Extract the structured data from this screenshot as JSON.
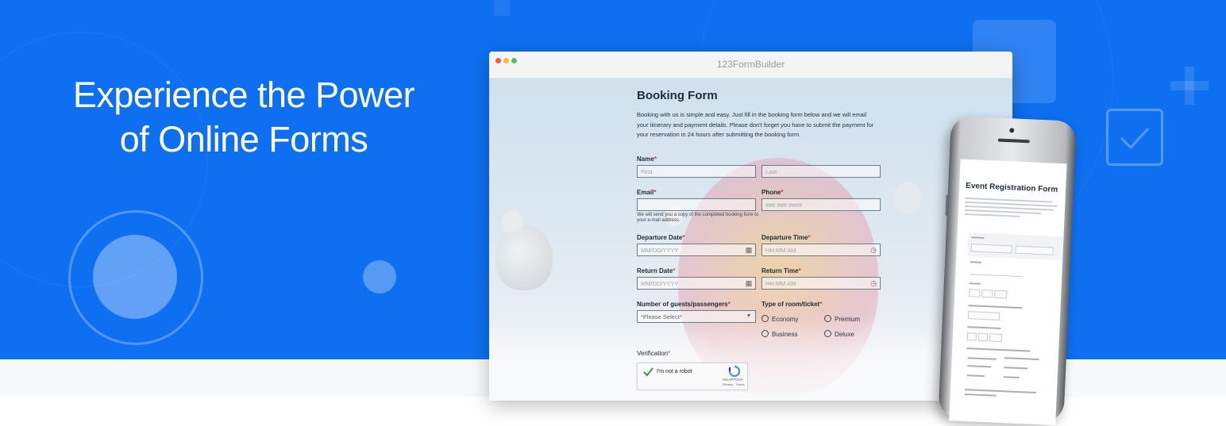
{
  "hero": {
    "headline_line1": "Experience the Power",
    "headline_line2": "of Online Forms"
  },
  "browser": {
    "title": "123FormBuilder"
  },
  "booking_form": {
    "title": "Booking Form",
    "description": "Booking with us is simple and easy. Just fill in the booking form below and we will email your itinerary and payment details.  Please don't forget you have to submit the payment for your reservation in 24 hours after submitting the booking form.",
    "name_label": "Name",
    "first_placeholder": "First",
    "last_placeholder": "Last",
    "email_label": "Email",
    "email_note": "We will send you a copy of the completed booking form to your e-mail address.",
    "phone_label": "Phone",
    "phone_placeholder": "### ### ####",
    "departure_date_label": "Departure Date",
    "departure_date_placeholder": "MM/DD/YYYY",
    "departure_time_label": "Departure Time",
    "departure_time_placeholder": "HH:MM AM",
    "return_date_label": "Return Date",
    "return_date_placeholder": "MM/DD/YYYY",
    "return_time_label": "Return Time",
    "return_time_placeholder": "HH:MM AM",
    "guests_label": "Number of guests/passengers",
    "guests_select_value": "*Please Select*",
    "room_label": "Type of room/ticket",
    "room_options": [
      "Economy",
      "Premium",
      "Business",
      "Deluxe"
    ],
    "verification_label": "Verification",
    "required_mark": "*",
    "captcha_label": "I'm not a robot",
    "captcha_brand": "reCAPTCHA",
    "captcha_links": "Privacy - Terms"
  },
  "phone_form": {
    "title": "Event Registration Form"
  },
  "colors": {
    "hero_blue": "#0e6ff0",
    "required_red": "#e0323c",
    "captcha_check": "#2e9e3f"
  }
}
